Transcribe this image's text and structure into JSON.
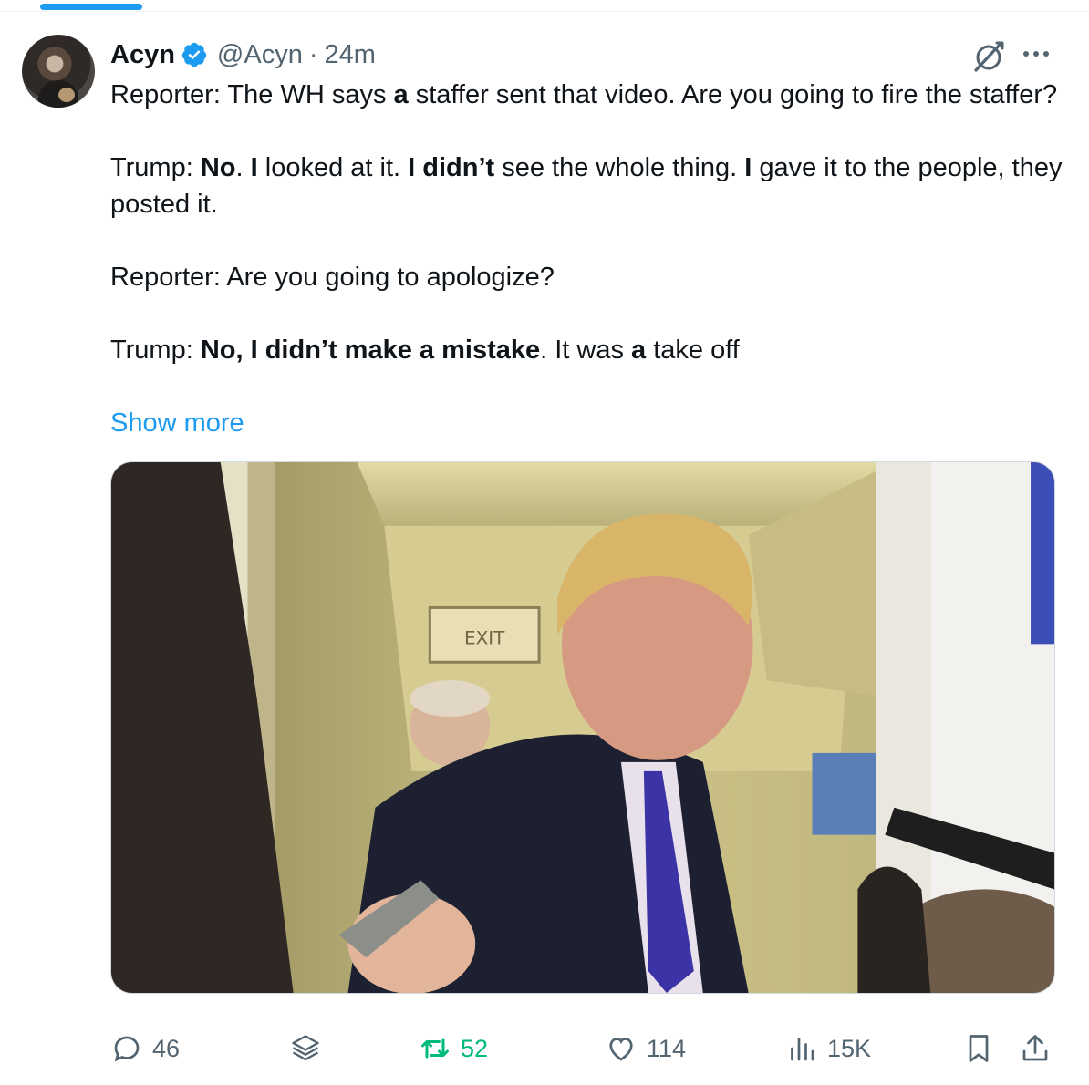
{
  "colors": {
    "accent": "#1d9bf0",
    "text": "#0f1419",
    "secondary": "#536471",
    "retweeted": "#00ba7c"
  },
  "tweet": {
    "author_name": "Acyn",
    "handle": "@Acyn",
    "separator": "·",
    "timestamp": "24m",
    "text": {
      "l1_a": "Reporter: The WH says ",
      "l1_b": "a",
      "l1_c": " staffer sent that video. Are you going to fire the staffer?",
      "l2_a": "Trump: ",
      "l2_b": "No",
      "l2_c": ". ",
      "l2_d": "I",
      "l2_e": " looked at it. ",
      "l2_f": "I didn’t",
      "l2_g": " see the whole thing. ",
      "l2_h": "I",
      "l2_i": " gave it to the people, they posted it.",
      "l3": "Reporter: Are you going to apologize?",
      "l4_a": "Trump: ",
      "l4_b": "No, I didn’t make a mistake",
      "l4_c": ". It was ",
      "l4_d": "a",
      "l4_e": " take off"
    },
    "show_more": "Show more",
    "media_sign": "EXIT",
    "actions": {
      "replies": "46",
      "retweets": "52",
      "likes": "114",
      "views": "15K"
    }
  },
  "icons": [
    "verified-badge-icon",
    "grok-icon",
    "more-icon",
    "reply-icon",
    "layers-icon",
    "retweet-icon",
    "like-icon",
    "views-icon",
    "bookmark-icon",
    "share-icon"
  ]
}
